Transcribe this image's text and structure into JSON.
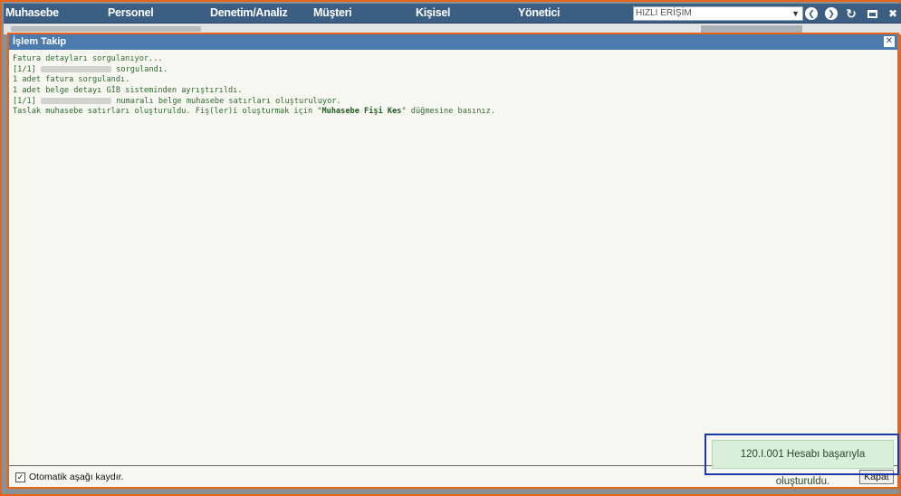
{
  "menu": {
    "items": [
      "Muhasebe",
      "Personel",
      "Denetim/Analiz",
      "Müşteri",
      "Kişisel",
      "Yönetici"
    ],
    "quick_access_placeholder": "HIZLI ERİŞİM"
  },
  "icons": {
    "back": "chevron-left-icon",
    "forward": "chevron-right-icon",
    "refresh": "refresh-icon",
    "maximize": "maximize-icon",
    "close": "close-icon"
  },
  "dialog": {
    "title": "İşlem Takip",
    "log_lines": [
      "Fatura detayları sorgulanıyor...",
      "[1/1]",
      "sorgulandı.",
      "1 adet fatura sorgulandı.",
      "1 adet belge detayı GİB sisteminden ayrıştırıldı.",
      "[1/1]",
      "numaralı belge muhasebe satırları oluşturuluyor.",
      "Taslak muhasebe satırları oluşturuldu. Fiş(ler)i oluşturmak için \"",
      "Muhasebe Fişi Kes",
      "\" düğmesine basınız."
    ],
    "auto_scroll_label": "Otomatik aşağı kaydır.",
    "close_button_label": "Kapat"
  },
  "toast": {
    "message": "120.I.001 Hesabı başarıyla oluşturuldu."
  },
  "colors": {
    "menu_bar": "#3b5f83",
    "dialog_title": "#4a7aae",
    "highlight_orange": "#e8641b",
    "highlight_blue": "#1f36a9",
    "toast_bg": "#d9efd9"
  }
}
